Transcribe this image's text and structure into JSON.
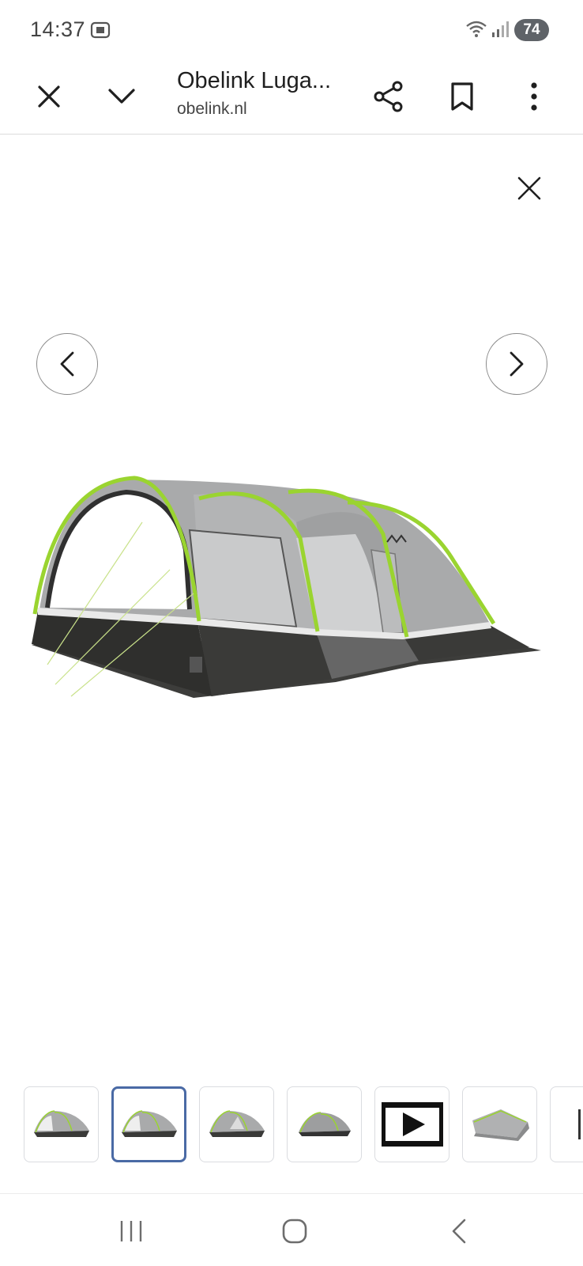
{
  "status_bar": {
    "time": "14:37",
    "battery": "74",
    "icons": [
      "screenshot-icon",
      "wifi-icon",
      "signal-icon",
      "battery-icon"
    ]
  },
  "app_bar": {
    "title": "Obelink Luga...",
    "domain": "obelink.nl",
    "icons": [
      "close-icon",
      "chevron-down-icon",
      "share-icon",
      "bookmark-icon",
      "more-vertical-icon"
    ]
  },
  "viewer": {
    "icons": [
      "close-icon",
      "chevron-left-icon",
      "chevron-right-icon"
    ],
    "main_image": "tent-image",
    "selected_thumbnail": 2,
    "thumbnails": [
      {
        "kind": "tent-image"
      },
      {
        "kind": "tent-image"
      },
      {
        "kind": "tent-image"
      },
      {
        "kind": "tent-image"
      },
      {
        "kind": "video-thumbnail"
      },
      {
        "kind": "tent-image"
      },
      {
        "kind": "tent-image"
      }
    ]
  },
  "system_nav": {
    "icons": [
      "recent-apps-icon",
      "home-icon",
      "back-icon"
    ]
  },
  "colors": {
    "accent_green": "#9ad430",
    "tent_grey": "#a9aaab",
    "tent_dark": "#3a3a38",
    "selected_border": "#4a6aa5"
  }
}
